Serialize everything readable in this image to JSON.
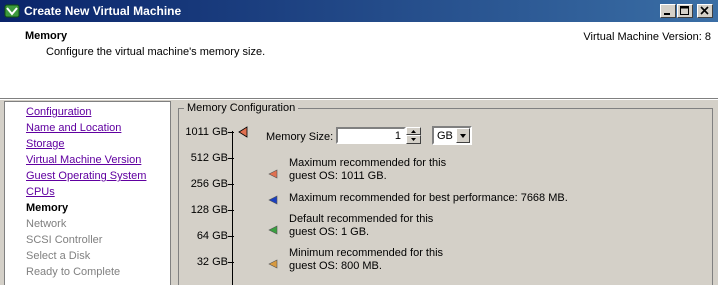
{
  "window": {
    "title": "Create New Virtual Machine"
  },
  "header": {
    "title": "Memory",
    "subtitle": "Configure the virtual machine's memory size.",
    "version": "Virtual Machine Version: 8"
  },
  "nav": {
    "items": [
      {
        "label": "Configuration",
        "state": "link"
      },
      {
        "label": "Name and Location",
        "state": "link"
      },
      {
        "label": "Storage",
        "state": "link"
      },
      {
        "label": "Virtual Machine Version",
        "state": "link"
      },
      {
        "label": "Guest Operating System",
        "state": "link"
      },
      {
        "label": "CPUs",
        "state": "link"
      },
      {
        "label": "Memory",
        "state": "current"
      },
      {
        "label": "Network",
        "state": "disabled"
      },
      {
        "label": "SCSI Controller",
        "state": "disabled"
      },
      {
        "label": "Select a Disk",
        "state": "disabled"
      },
      {
        "label": "Ready to Complete",
        "state": "disabled"
      }
    ]
  },
  "memory_config": {
    "legend": "Memory Configuration",
    "size_label": "Memory Size:",
    "size_value": "1",
    "unit": "GB",
    "scale_ticks": [
      "1011 GB",
      "512 GB",
      "256 GB",
      "128 GB",
      "64 GB",
      "32 GB"
    ],
    "recommendations": [
      {
        "line1": "Maximum recommended for this",
        "line2": "guest OS: 1011 GB.",
        "color": "#e07050",
        "icon": "orange-marker-icon"
      },
      {
        "line1": "Maximum recommended for best performance: 7668 MB.",
        "line2": "",
        "color": "#1a3fc0",
        "icon": "blue-marker-icon"
      },
      {
        "line1": "Default recommended for this",
        "line2": "guest OS: 1 GB.",
        "color": "#3aa040",
        "icon": "green-marker-icon"
      },
      {
        "line1": "Minimum recommended for this",
        "line2": "guest OS: 800 MB.",
        "color": "#d89a40",
        "icon": "yellow-marker-icon"
      }
    ],
    "slider_marker_color": "#e07050"
  }
}
